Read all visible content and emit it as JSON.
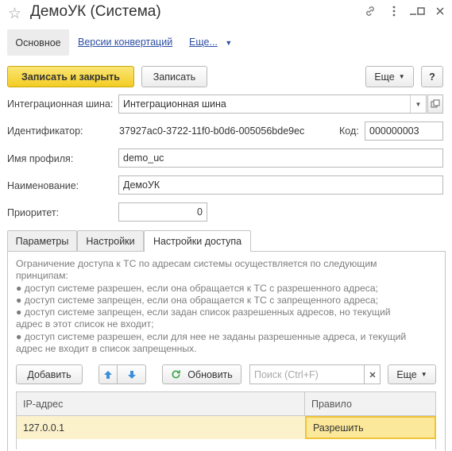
{
  "window": {
    "title": "ДемоУК (Система)",
    "icons": [
      "star-icon",
      "link-icon",
      "more-vertical-icon",
      "minimize-icon",
      "maximize-icon",
      "close-icon"
    ]
  },
  "nav": {
    "main": "Основное",
    "versions": "Версии конвертаций",
    "more": "Еще..."
  },
  "toolbar": {
    "save_close": "Записать и закрыть",
    "save": "Записать",
    "more": "Еще",
    "help": "?"
  },
  "form": {
    "bus_label": "Интеграционная шина:",
    "bus_value": "Интеграционная шина",
    "id_label": "Идентификатор:",
    "id_value": "37927ac0-3722-11f0-b0d6-005056bde9ec",
    "code_label": "Код:",
    "code_value": "000000003",
    "profile_label": "Имя профиля:",
    "profile_value": "demo_uc",
    "name_label": "Наименование:",
    "name_value": "ДемоУК",
    "priority_label": "Приоритет:",
    "priority_value": "0"
  },
  "tabs": {
    "params": "Параметры",
    "settings": "Настройки",
    "access": "Настройки доступа"
  },
  "access": {
    "info_lines": [
      "Ограничение доступа к ТС по адресам системы осуществляется по следующим",
      "принципам:",
      "● доступ системе разрешен, если она обращается к ТС с разрешенного адреса;",
      "● доступ системе запрещен, если она обращается к ТС с запрещенного адреса;",
      "● доступ системе запрещен, если задан список разрешенных адресов, но текущий",
      "адрес в этот список не входит;",
      "● доступ системе разрешен, если для нее не заданы разрешенные адреса, и текущий",
      "адрес не входит в список запрещенных."
    ],
    "add": "Добавить",
    "refresh": "Обновить",
    "search_placeholder": "Поиск (Ctrl+F)",
    "more": "Еще",
    "columns": {
      "ip": "IP-адрес",
      "rule": "Правило"
    },
    "rows": [
      {
        "ip": "127.0.0.1",
        "rule": "Разрешить"
      }
    ]
  },
  "colors": {
    "primary": "#f3cd24",
    "link": "#2c4ea3",
    "selected_row": "#fbf2cc"
  }
}
